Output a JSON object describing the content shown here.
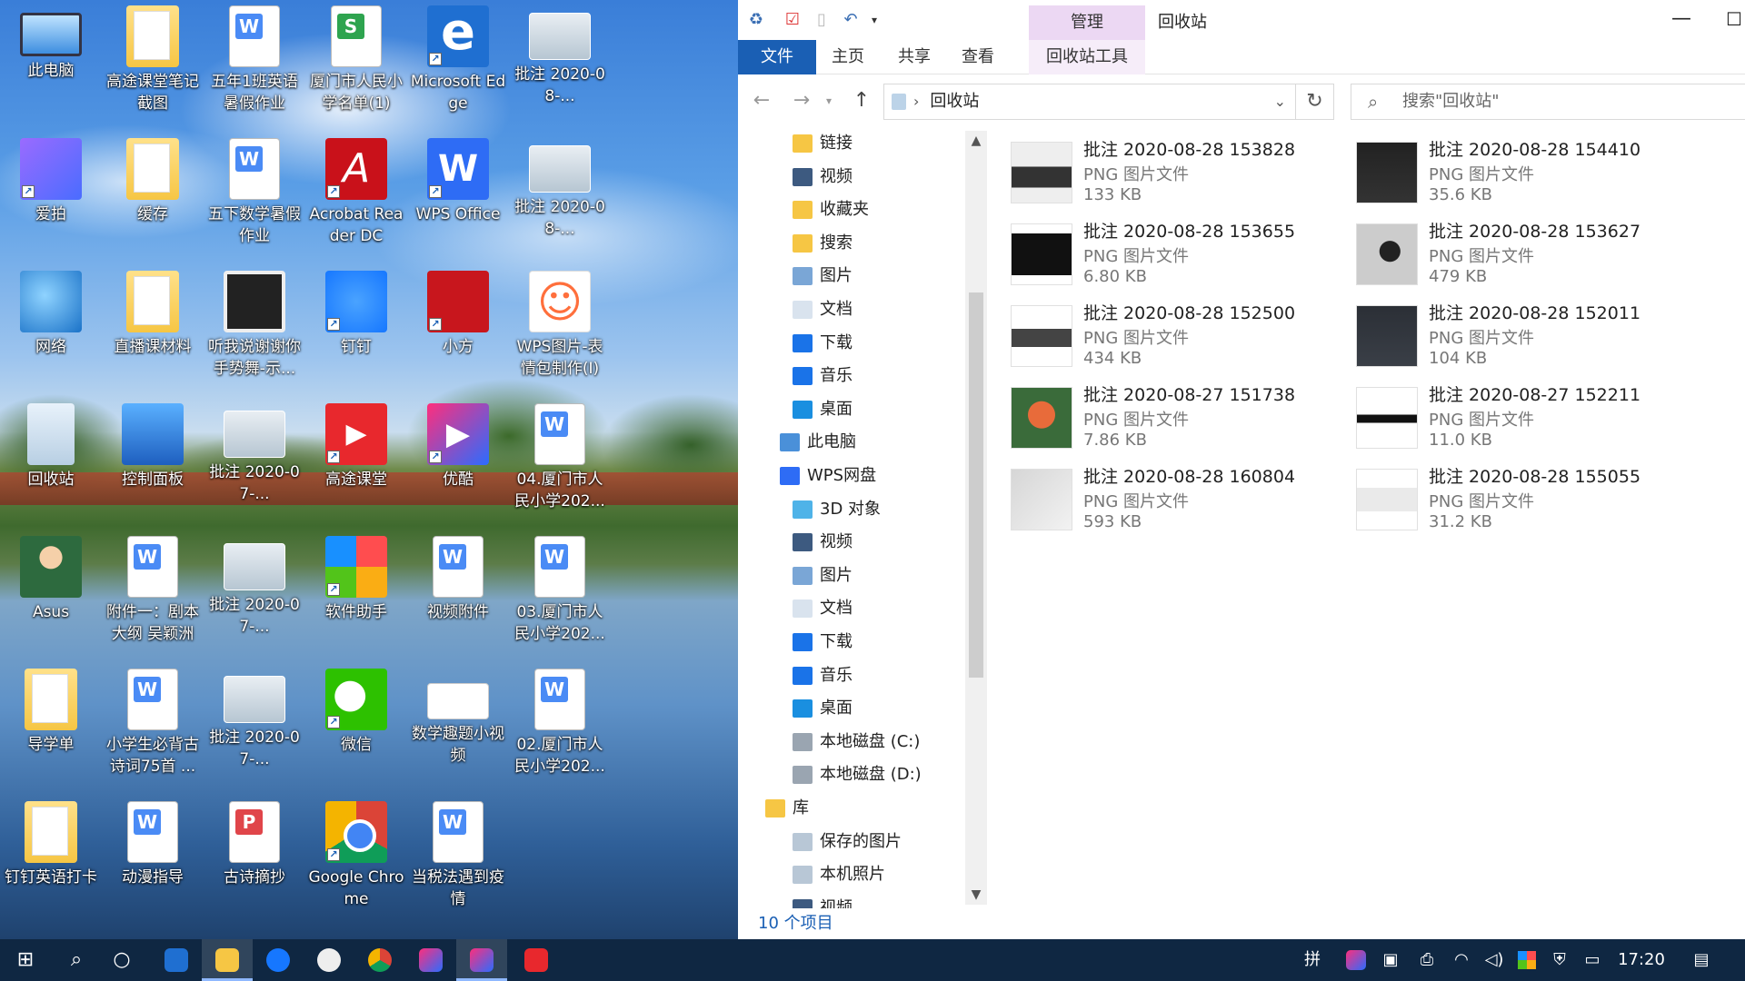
{
  "desktop": {
    "icons": [
      {
        "label": "此电脑",
        "icon": "computer-icon"
      },
      {
        "label": "高途课堂笔记截图",
        "icon": "folder-icon"
      },
      {
        "label": "五年1班英语暑假作业",
        "icon": "word-doc-icon"
      },
      {
        "label": "厦门市人民小学名单(1)",
        "icon": "spreadsheet-doc-icon"
      },
      {
        "label": "Microsoft Edge",
        "icon": "edge-browser-icon"
      },
      {
        "label": "批注 2020-08-...",
        "icon": "screenshot-image-icon"
      },
      {
        "label": "爱拍",
        "icon": "aipai-app-icon"
      },
      {
        "label": "缓存",
        "icon": "folder-icon"
      },
      {
        "label": "五下数学暑假作业",
        "icon": "word-doc-icon"
      },
      {
        "label": "Acrobat Reader DC",
        "icon": "acrobat-reader-icon"
      },
      {
        "label": "WPS Office",
        "icon": "wps-office-icon"
      },
      {
        "label": "批注 2020-08-...",
        "icon": "screenshot-image-icon"
      },
      {
        "label": "网络",
        "icon": "network-icon"
      },
      {
        "label": "直播课材料",
        "icon": "folder-icon"
      },
      {
        "label": "听我说谢谢你手势舞-示...",
        "icon": "video-file-icon"
      },
      {
        "label": "钉钉",
        "icon": "dingtalk-icon"
      },
      {
        "label": "小方",
        "icon": "fangzheng-securities-icon"
      },
      {
        "label": "WPS图片-表情包制作(I)",
        "icon": "emoji-maker-icon"
      },
      {
        "label": "回收站",
        "icon": "recycle-bin-icon"
      },
      {
        "label": "控制面板",
        "icon": "control-panel-icon"
      },
      {
        "label": "批注 2020-07-...",
        "icon": "screenshot-image-icon"
      },
      {
        "label": "高途课堂",
        "icon": "gaotu-app-icon"
      },
      {
        "label": "优酷",
        "icon": "youku-icon"
      },
      {
        "label": "04.厦门市人民小学202...",
        "icon": "word-doc-icon"
      },
      {
        "label": "Asus",
        "icon": "user-folder-icon"
      },
      {
        "label": "附件一：剧本大纲 吴颖洲",
        "icon": "word-doc-icon"
      },
      {
        "label": "批注 2020-07-...",
        "icon": "screenshot-image-icon"
      },
      {
        "label": "软件助手",
        "icon": "software-helper-icon"
      },
      {
        "label": "视频附件",
        "icon": "word-doc-icon"
      },
      {
        "label": "03.厦门市人民小学202...",
        "icon": "word-doc-icon"
      },
      {
        "label": "导学单",
        "icon": "folder-icon"
      },
      {
        "label": "小学生必背古诗词75首 ...",
        "icon": "word-doc-icon"
      },
      {
        "label": "批注 2020-07-...",
        "icon": "screenshot-image-icon"
      },
      {
        "label": "微信",
        "icon": "wechat-icon"
      },
      {
        "label": "数学趣题小视频",
        "icon": "blank-file-icon"
      },
      {
        "label": "02.厦门市人民小学202...",
        "icon": "word-doc-icon"
      },
      {
        "label": "钉钉英语打卡",
        "icon": "folder-icon"
      },
      {
        "label": "动漫指导",
        "icon": "word-doc-icon"
      },
      {
        "label": "古诗摘抄",
        "icon": "wps-presentation-icon"
      },
      {
        "label": "Google Chrome",
        "icon": "chrome-icon"
      },
      {
        "label": "当税法遇到疫情",
        "icon": "word-doc-icon"
      }
    ]
  },
  "explorer": {
    "context_tab": "管理",
    "window_title": "回收站",
    "ribbon_tabs": [
      "文件",
      "主页",
      "共享",
      "查看",
      "回收站工具"
    ],
    "address": {
      "path": "回收站"
    },
    "search": {
      "placeholder": "搜索\"回收站\""
    },
    "nav_items": [
      {
        "label": "链接",
        "icon": "links-folder-icon"
      },
      {
        "label": "视频",
        "icon": "videos-folder-icon"
      },
      {
        "label": "收藏夹",
        "icon": "favorites-folder-icon"
      },
      {
        "label": "搜索",
        "icon": "searches-folder-icon"
      },
      {
        "label": "图片",
        "icon": "pictures-folder-icon"
      },
      {
        "label": "文档",
        "icon": "documents-folder-icon"
      },
      {
        "label": "下载",
        "icon": "downloads-folder-icon"
      },
      {
        "label": "音乐",
        "icon": "music-folder-icon"
      },
      {
        "label": "桌面",
        "icon": "desktop-folder-icon"
      },
      {
        "label": "此电脑",
        "icon": "this-pc-icon"
      },
      {
        "label": "WPS网盘",
        "icon": "wps-cloud-icon"
      },
      {
        "label": "3D 对象",
        "icon": "3d-objects-icon"
      },
      {
        "label": "视频",
        "icon": "videos-folder-icon"
      },
      {
        "label": "图片",
        "icon": "pictures-folder-icon"
      },
      {
        "label": "文档",
        "icon": "documents-folder-icon"
      },
      {
        "label": "下载",
        "icon": "downloads-folder-icon"
      },
      {
        "label": "音乐",
        "icon": "music-folder-icon"
      },
      {
        "label": "桌面",
        "icon": "desktop-folder-icon"
      },
      {
        "label": "本地磁盘 (C:)",
        "icon": "drive-c-icon"
      },
      {
        "label": "本地磁盘 (D:)",
        "icon": "drive-d-icon"
      },
      {
        "label": "库",
        "icon": "libraries-icon"
      },
      {
        "label": "保存的图片",
        "icon": "saved-pictures-icon"
      },
      {
        "label": "本机照片",
        "icon": "camera-roll-icon"
      },
      {
        "label": "视频",
        "icon": "videos-folder-icon"
      }
    ],
    "files": [
      {
        "name": "批注 2020-08-28 153828",
        "type": "PNG 图片文件",
        "size": "133 KB"
      },
      {
        "name": "批注 2020-08-28 154410",
        "type": "PNG 图片文件",
        "size": "35.6 KB"
      },
      {
        "name": "批注 2020-08-28 153655",
        "type": "PNG 图片文件",
        "size": "6.80 KB"
      },
      {
        "name": "批注 2020-08-28 153627",
        "type": "PNG 图片文件",
        "size": "479 KB"
      },
      {
        "name": "批注 2020-08-28 152500",
        "type": "PNG 图片文件",
        "size": "434 KB"
      },
      {
        "name": "批注 2020-08-28 152011",
        "type": "PNG 图片文件",
        "size": "104 KB"
      },
      {
        "name": "批注 2020-08-27 151738",
        "type": "PNG 图片文件",
        "size": "7.86 KB"
      },
      {
        "name": "批注 2020-08-27 152211",
        "type": "PNG 图片文件",
        "size": "11.0 KB"
      },
      {
        "name": "批注 2020-08-28 160804",
        "type": "PNG 图片文件",
        "size": "593 KB"
      },
      {
        "name": "批注 2020-08-28 155055",
        "type": "PNG 图片文件",
        "size": "31.2 KB"
      }
    ],
    "status": "10 个项目"
  },
  "taskbar": {
    "ime": "拼",
    "clock": "17:20",
    "accent": "#1a5fb4"
  }
}
